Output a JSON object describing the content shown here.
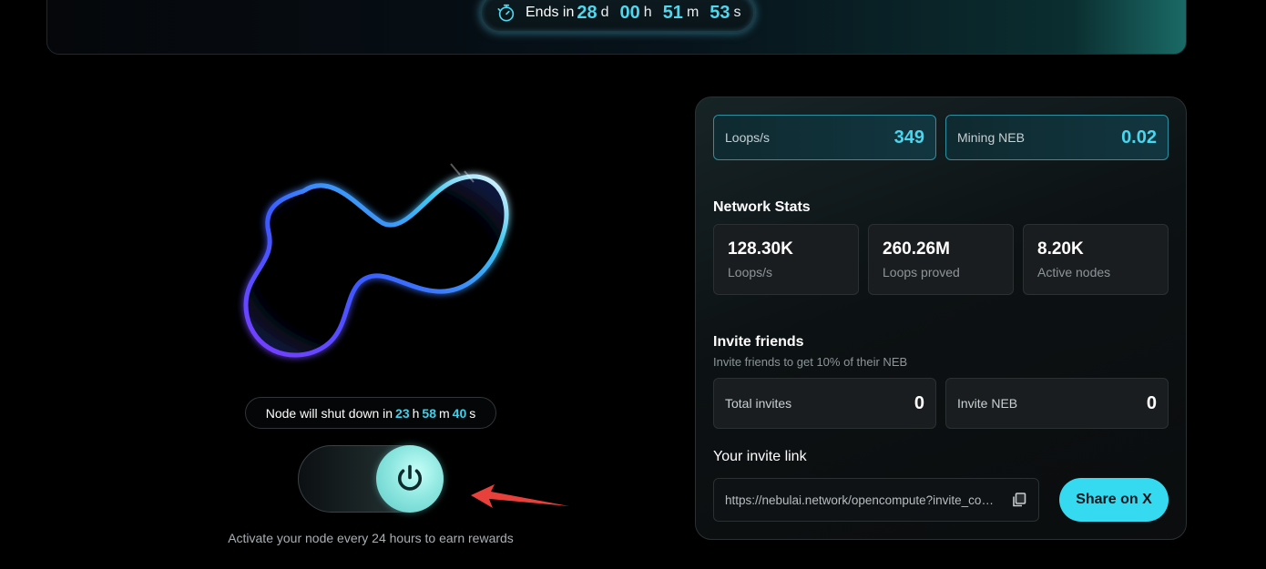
{
  "banner": {
    "ends_label": "Ends in",
    "days_value": "28",
    "days_unit": "d",
    "hours_value": "00",
    "hours_unit": "h",
    "minutes_value": "51",
    "minutes_unit": "m",
    "seconds_value": "53",
    "seconds_unit": "s"
  },
  "node": {
    "shutdown_label": "Node will shut down in",
    "hours_value": "23",
    "hours_unit": "h",
    "minutes_value": "58",
    "minutes_unit": "m",
    "seconds_value": "40",
    "seconds_unit": "s",
    "toggle_on": true,
    "activate_text": "Activate your node every 24 hours to earn rewards"
  },
  "mining": {
    "loops_label": "Loops/s",
    "loops_value": "349",
    "neb_label": "Mining NEB",
    "neb_value": "0.02"
  },
  "network": {
    "title": "Network Stats",
    "cards": [
      {
        "value": "128.30K",
        "label": "Loops/s"
      },
      {
        "value": "260.26M",
        "label": "Loops proved"
      },
      {
        "value": "8.20K",
        "label": "Active nodes"
      }
    ]
  },
  "invite": {
    "title": "Invite friends",
    "subtitle": "Invite friends to get 10% of their NEB",
    "total_label": "Total invites",
    "total_value": "0",
    "neb_label": "Invite NEB",
    "neb_value": "0",
    "link_title": "Your invite link",
    "link_url": "https://nebulai.network/opencompute?invite_code=",
    "share_label": "Share on X"
  },
  "colors": {
    "accent": "#35d9f0",
    "highlight": "#4fd7ee",
    "annotation_arrow": "#e8413b"
  }
}
